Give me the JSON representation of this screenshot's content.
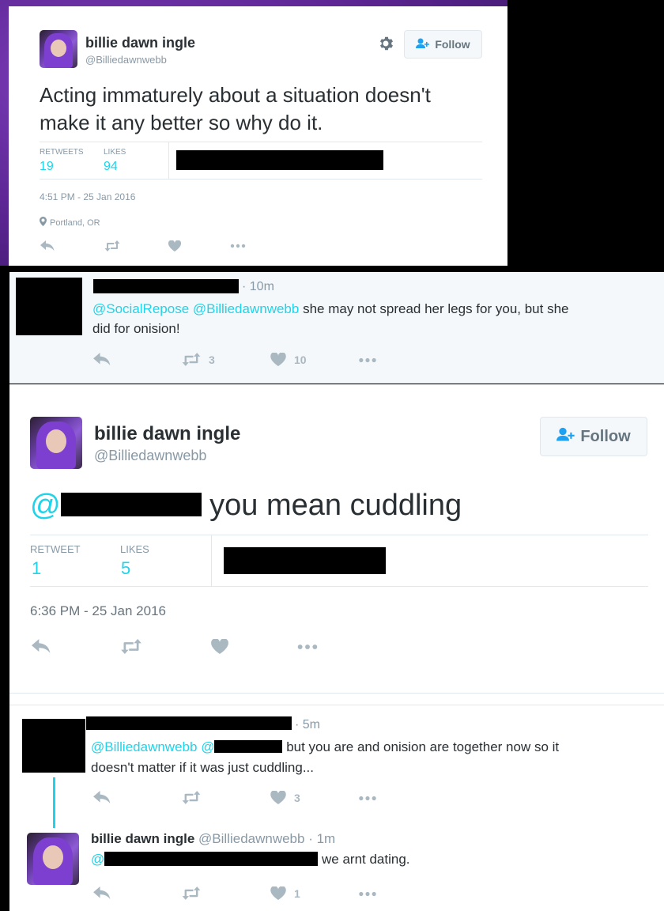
{
  "tweet1": {
    "name": "billie dawn ingle",
    "handle": "@Billiedawnwebb",
    "follow_label": "Follow",
    "text": "Acting immaturely about a situation doesn't make it any better so why do it.",
    "retweets_label": "RETWEETS",
    "retweets": "19",
    "likes_label": "LIKES",
    "likes": "94",
    "timestamp": "4:51 PM - 25 Jan 2016",
    "location": "Portland, OR"
  },
  "reply1": {
    "time": "· 10m",
    "mention1": "@SocialRepose",
    "mention2": "@Billiedawnwebb",
    "text_line1": "she may not spread her legs for you, but she",
    "text_line2": "did for onision!",
    "retweet_count": "3",
    "like_count": "10"
  },
  "tweet2": {
    "name": "billie dawn ingle",
    "handle": "@Billiedawnwebb",
    "follow_label": "Follow",
    "mention_prefix": "@",
    "text": "you mean cuddling",
    "retweet_label": "RETWEET",
    "retweets": "1",
    "likes_label": "LIKES",
    "likes": "5",
    "timestamp": "6:36 PM - 25 Jan 2016"
  },
  "reply2": {
    "time": "· 5m",
    "mention1": "@Billiedawnwebb",
    "mention2_prefix": "@",
    "text_line1": "but you are and onision are together now so it",
    "text_line2": "doesn't matter if it was just cuddling...",
    "like_count": "3"
  },
  "reply3": {
    "name": "billie dawn ingle",
    "handle": "@Billiedawnwebb",
    "time": "· 1m",
    "mention_prefix": "@",
    "text": "we arnt dating.",
    "like_count": "1"
  },
  "icons": [
    "gear-icon",
    "follow-person-icon",
    "location-pin-icon",
    "reply-icon",
    "retweet-icon",
    "heart-icon",
    "more-icon"
  ],
  "colors": {
    "link": "#1dd4ea",
    "purple_bg": "#6a2fa0",
    "card": "#ffffff",
    "reply_bg": "#f5f8fa"
  }
}
